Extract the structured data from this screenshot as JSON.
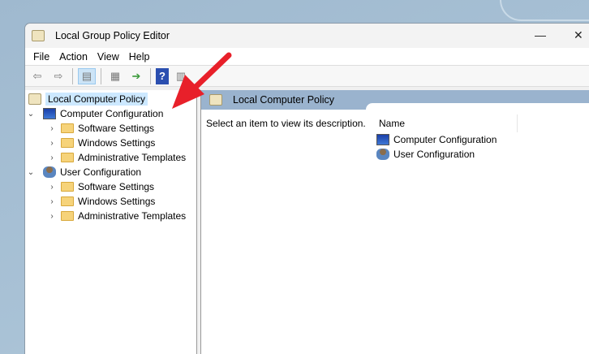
{
  "window": {
    "title": "Local Group Policy Editor",
    "minimize": "—",
    "close": "✕"
  },
  "menu": [
    "File",
    "Action",
    "View",
    "Help"
  ],
  "toolbar": [
    "back",
    "forward",
    "show-hide-console-tree",
    "properties",
    "export-list",
    "help",
    "show-hide-action-pane"
  ],
  "tree": {
    "root": "Local Computer Policy",
    "computer": {
      "label": "Computer Configuration",
      "children": [
        "Software Settings",
        "Windows Settings",
        "Administrative Templates"
      ]
    },
    "user": {
      "label": "User Configuration",
      "children": [
        "Software Settings",
        "Windows Settings",
        "Administrative Templates"
      ]
    }
  },
  "right": {
    "header": "Local Computer Policy",
    "description": "Select an item to view its description.",
    "column": "Name",
    "items": [
      "Computer Configuration",
      "User Configuration"
    ]
  },
  "colors": {
    "arrow": "#e8202a",
    "header": "#9ab3ce",
    "selection": "#cce8ff"
  }
}
